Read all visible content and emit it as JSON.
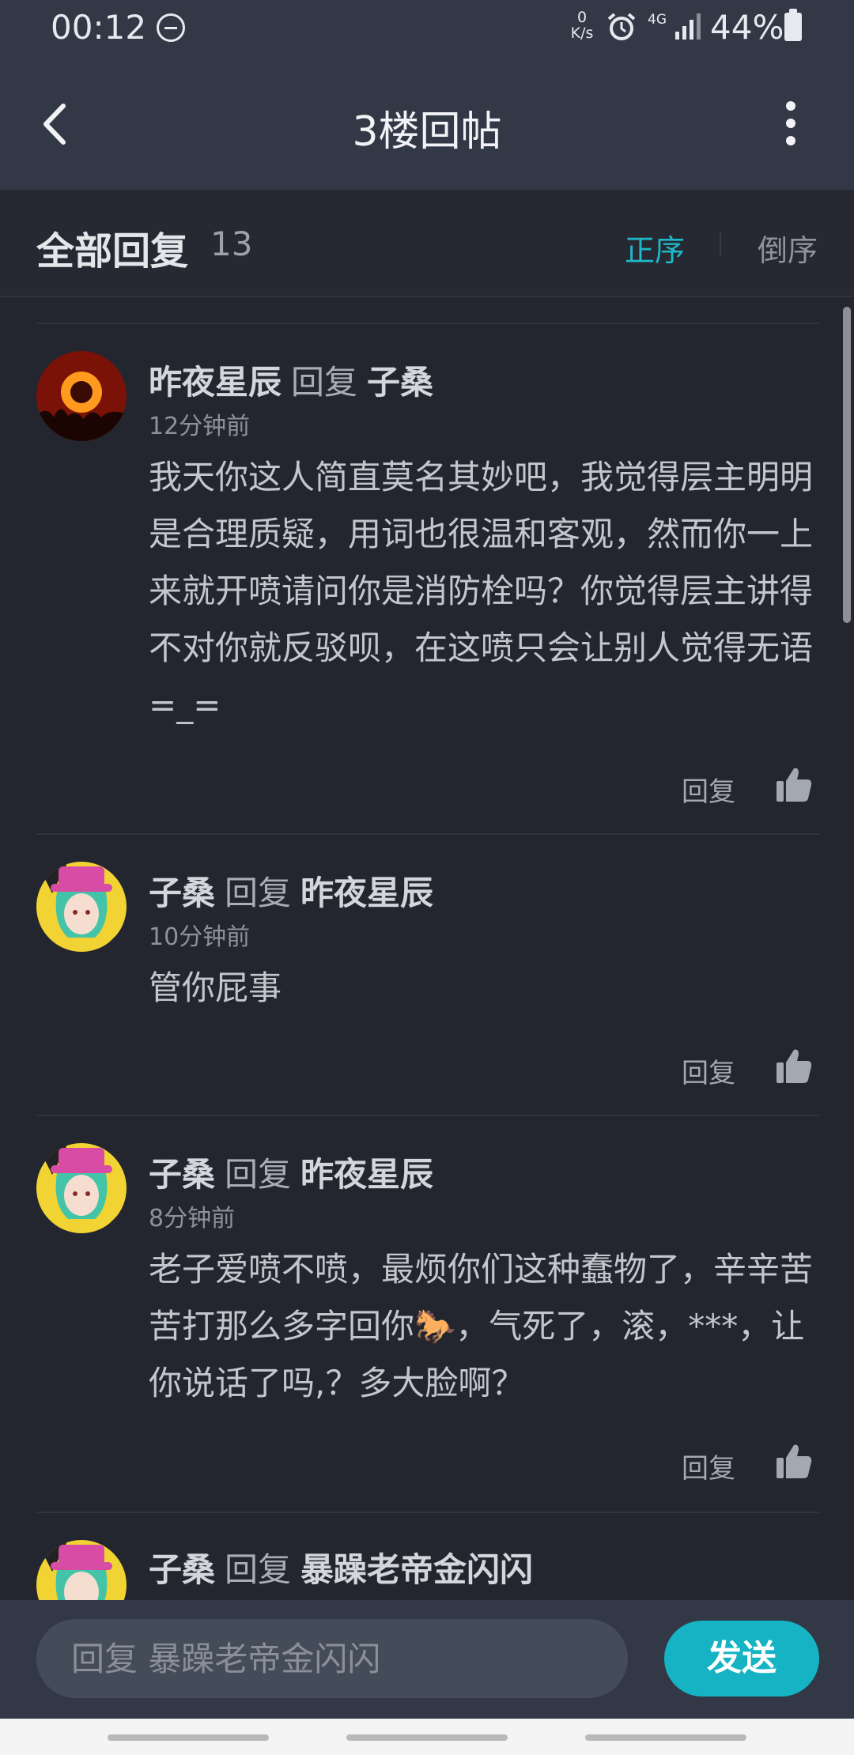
{
  "status_bar": {
    "time": "00:12",
    "speed_value": "0",
    "speed_unit": "K/s",
    "network": "4G",
    "battery": "44%"
  },
  "header": {
    "title": "3楼回帖"
  },
  "reply_header": {
    "title": "全部回复",
    "count": "13",
    "sort_asc": "正序",
    "sort_desc": "倒序"
  },
  "comments": [
    {
      "user": "昨夜星辰",
      "reply_word": "回复",
      "target": "子桑",
      "time": "12分钟前",
      "body": "我天你这人简直莫名其妙吧，我觉得层主明明是合理质疑，用词也很温和客观，然而你一上来就开喷请问你是消防栓吗？你觉得层主讲得不对你就反驳呗，在这喷只会让别人觉得无语=_=",
      "reply_label": "回复"
    },
    {
      "user": "子桑",
      "reply_word": "回复",
      "target": "昨夜星辰",
      "time": "10分钟前",
      "body": "管你屁事",
      "reply_label": "回复"
    },
    {
      "user": "子桑",
      "reply_word": "回复",
      "target": "昨夜星辰",
      "time": "8分钟前",
      "body": "老子爱喷不喷，最烦你们这种蠢物了，辛辛苦苦打那么多字回你🐎，气死了，滚，***，让你说话了吗,？多大脸啊？",
      "reply_label": "回复"
    },
    {
      "user": "子桑",
      "reply_word": "回复",
      "target": "暴躁老帝金闪闪"
    }
  ],
  "composer": {
    "placeholder": "回复 暴躁老帝金闪闪",
    "send_label": "发送"
  },
  "colors": {
    "accent": "#15b3c3",
    "background": "#24262f",
    "bar": "#323845"
  }
}
